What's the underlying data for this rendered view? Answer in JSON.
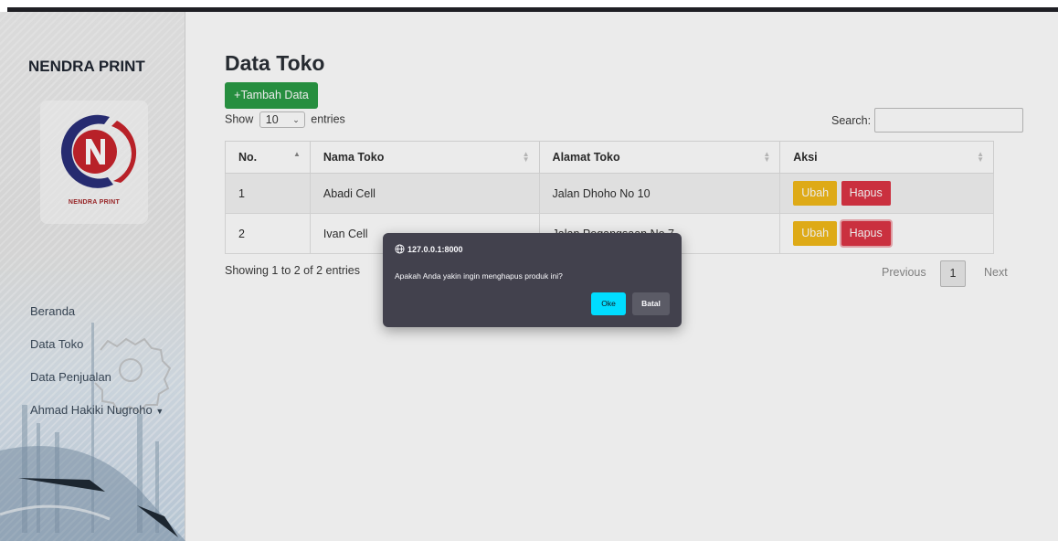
{
  "sidebar": {
    "brand": "NENDRA PRINT",
    "logo_text": "NENDRA PRINT",
    "items": [
      {
        "label": "Beranda"
      },
      {
        "label": "Data Toko"
      },
      {
        "label": "Data Penjualan"
      },
      {
        "label": "Ahmad Hakiki Nugroho"
      }
    ]
  },
  "main": {
    "title": "Data Toko",
    "add_button": "+Tambah Data",
    "length": {
      "prefix": "Show",
      "value": "10",
      "suffix": "entries"
    },
    "search": {
      "label": "Search:",
      "value": ""
    },
    "table": {
      "headers": [
        "No.",
        "Nama Toko",
        "Alamat Toko",
        "Aksi"
      ],
      "rows": [
        {
          "no": "1",
          "nama": "Abadi Cell",
          "alamat": "Jalan Dhoho No 10",
          "edit": "Ubah",
          "delete": "Hapus"
        },
        {
          "no": "2",
          "nama": "Ivan Cell",
          "alamat": "Jalan Pegangsaan No 7",
          "edit": "Ubah",
          "delete": "Hapus"
        }
      ]
    },
    "info": "Showing 1 to 2 of 2 entries",
    "pagination": {
      "previous": "Previous",
      "current": "1",
      "next": "Next"
    }
  },
  "dialog": {
    "origin": "127.0.0.1:8000",
    "message": "Apakah Anda yakin ingin menghapus produk ini?",
    "ok": "Oke",
    "cancel": "Batal"
  },
  "colors": {
    "add": "#2a9b45",
    "edit": "#f1b91a",
    "delete": "#dc3545",
    "dialog_bg": "#42414d",
    "dialog_ok": "#00ddff"
  }
}
